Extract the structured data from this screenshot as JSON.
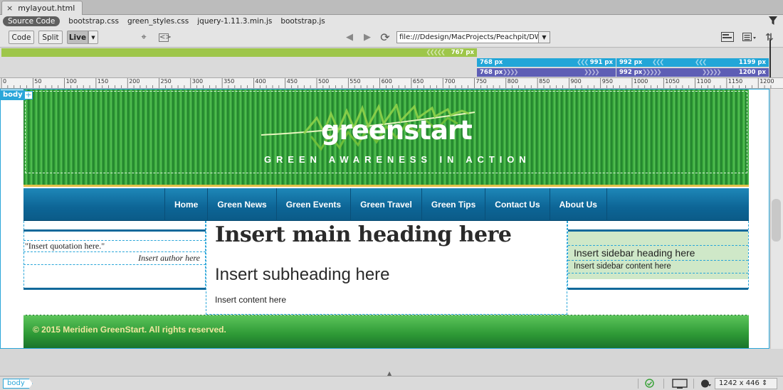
{
  "tab": {
    "title": "mylayout.html",
    "close": "×"
  },
  "related_files": [
    "Source Code",
    "bootstrap.css",
    "green_styles.css",
    "jquery-1.11.3.min.js",
    "bootstrap.js"
  ],
  "toolbar": {
    "code_label": "Code",
    "split_label": "Split",
    "live_label": "Live",
    "address": "file:///Ddesign/MacProjects/Peachpit/DWC..."
  },
  "media_queries": {
    "green": "767  px",
    "cyan_left_start": "768  px",
    "cyan_left_end": "991  px",
    "cyan_right_start": "992  px",
    "cyan_right_end": "1199  px",
    "purple_left_start": "768  px",
    "purple_right_start": "992  px",
    "purple_right_end": "1200  px"
  },
  "ruler": {
    "labels": [
      "0",
      "50",
      "100",
      "150",
      "200",
      "250",
      "300",
      "350",
      "400",
      "450",
      "500",
      "550",
      "600",
      "650",
      "700",
      "750",
      "800",
      "850",
      "900",
      "950",
      "1000",
      "1050",
      "1100",
      "1150",
      "1200"
    ]
  },
  "element_tag": {
    "label": "body",
    "plus": "+"
  },
  "page": {
    "logo_text": "greenstart",
    "tagline": "GREEN AWARENESS IN ACTION",
    "nav": [
      "Home",
      "Green News",
      "Green Events",
      "Green Travel",
      "Green Tips",
      "Contact Us",
      "About Us"
    ],
    "quote": "\"Insert quotation here.\"",
    "author": "Insert author here",
    "main_heading": "Insert main heading here",
    "subheading": "Insert subheading here",
    "content": "Insert content here",
    "sidebar_heading": "Insert sidebar heading here",
    "sidebar_content": "Insert sidebar content here",
    "footer": "© 2015 Meridien GreenStart. All rights reserved."
  },
  "status": {
    "tag": "body",
    "dimensions": "1242 x 446 ⇕"
  },
  "colors": {
    "accent": "#2aa6d9",
    "header_green": "#2f9a35",
    "nav_blue": "#0d6596",
    "sidebar_bg": "#cfe8c8",
    "mq_green": "#9ec64a",
    "mq_cyan": "#22a6d8",
    "mq_purple": "#5e5eb5"
  }
}
